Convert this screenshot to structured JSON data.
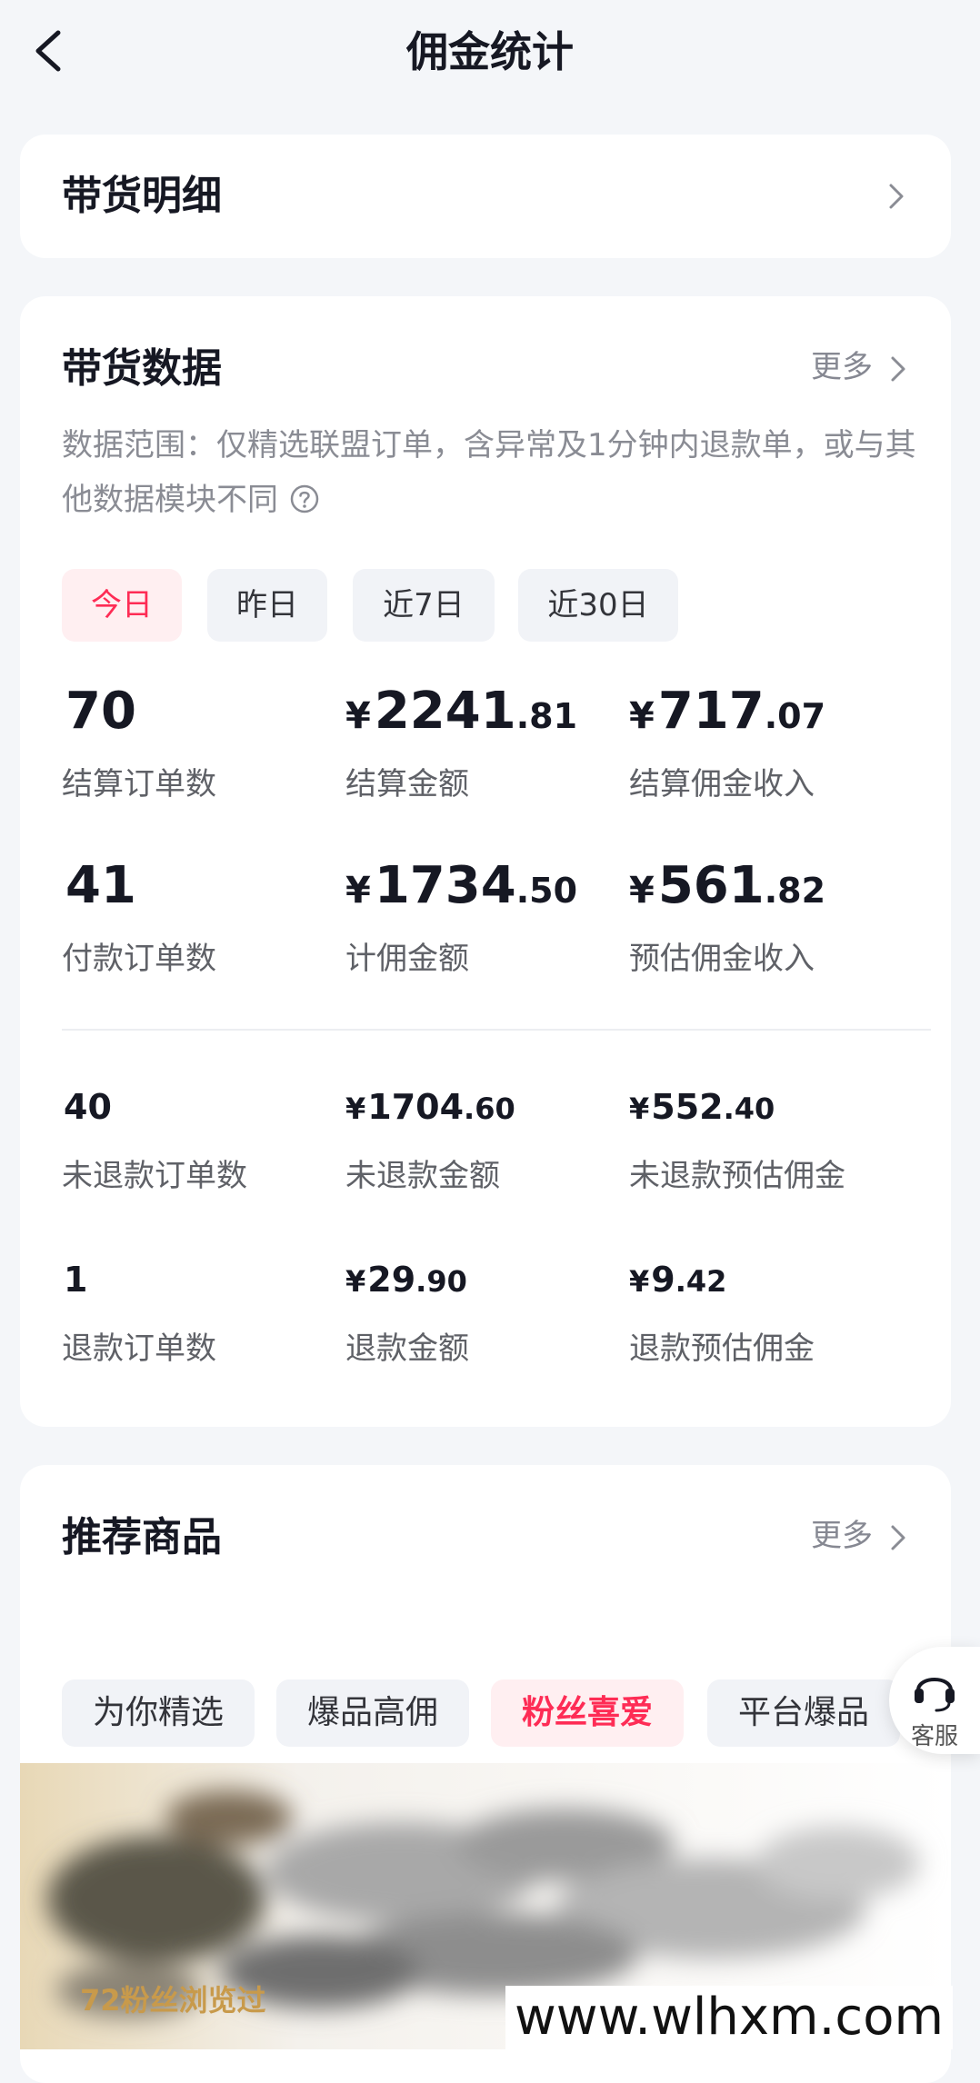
{
  "header": {
    "title": "佣金统计"
  },
  "detail": {
    "label": "带货明细"
  },
  "sales": {
    "title": "带货数据",
    "more": "更多",
    "scope": "数据范围：仅精选联盟订单，含异常及1分钟内退款单，或与其他数据模块不同",
    "periods": [
      "今日",
      "昨日",
      "近7日",
      "近30日"
    ],
    "active_period": "今日",
    "stats_top": [
      {
        "cur": "",
        "int": "70",
        "dec": "",
        "label": "结算订单数"
      },
      {
        "cur": "¥",
        "int": "2241",
        "dec": ".81",
        "label": "结算金额"
      },
      {
        "cur": "¥",
        "int": "717",
        "dec": ".07",
        "label": "结算佣金收入"
      },
      {
        "cur": "",
        "int": "41",
        "dec": "",
        "label": "付款订单数"
      },
      {
        "cur": "¥",
        "int": "1734",
        "dec": ".50",
        "label": "计佣金额"
      },
      {
        "cur": "¥",
        "int": "561",
        "dec": ".82",
        "label": "预估佣金收入"
      }
    ],
    "stats_bottom": [
      {
        "cur": "",
        "int": "40",
        "dec": "",
        "label": "未退款订单数"
      },
      {
        "cur": "¥",
        "int": "1704",
        "dec": ".60",
        "label": "未退款金额"
      },
      {
        "cur": "¥",
        "int": "552",
        "dec": ".40",
        "label": "未退款预估佣金"
      },
      {
        "cur": "",
        "int": "1",
        "dec": "",
        "label": "退款订单数"
      },
      {
        "cur": "¥",
        "int": "29",
        "dec": ".90",
        "label": "退款金额"
      },
      {
        "cur": "¥",
        "int": "9",
        "dec": ".42",
        "label": "退款预估佣金"
      }
    ]
  },
  "recommend": {
    "title": "推荐商品",
    "more": "更多",
    "tabs": [
      "为你精选",
      "爆品高佣",
      "粉丝喜爱",
      "平台爆品"
    ],
    "active_tab": "粉丝喜爱",
    "cs_label": "客服",
    "views": "72粉丝浏览过"
  },
  "watermark": "www.wlhxm.com",
  "colors": {
    "accent": "#fe2c55",
    "background": "#f4f6f9"
  }
}
